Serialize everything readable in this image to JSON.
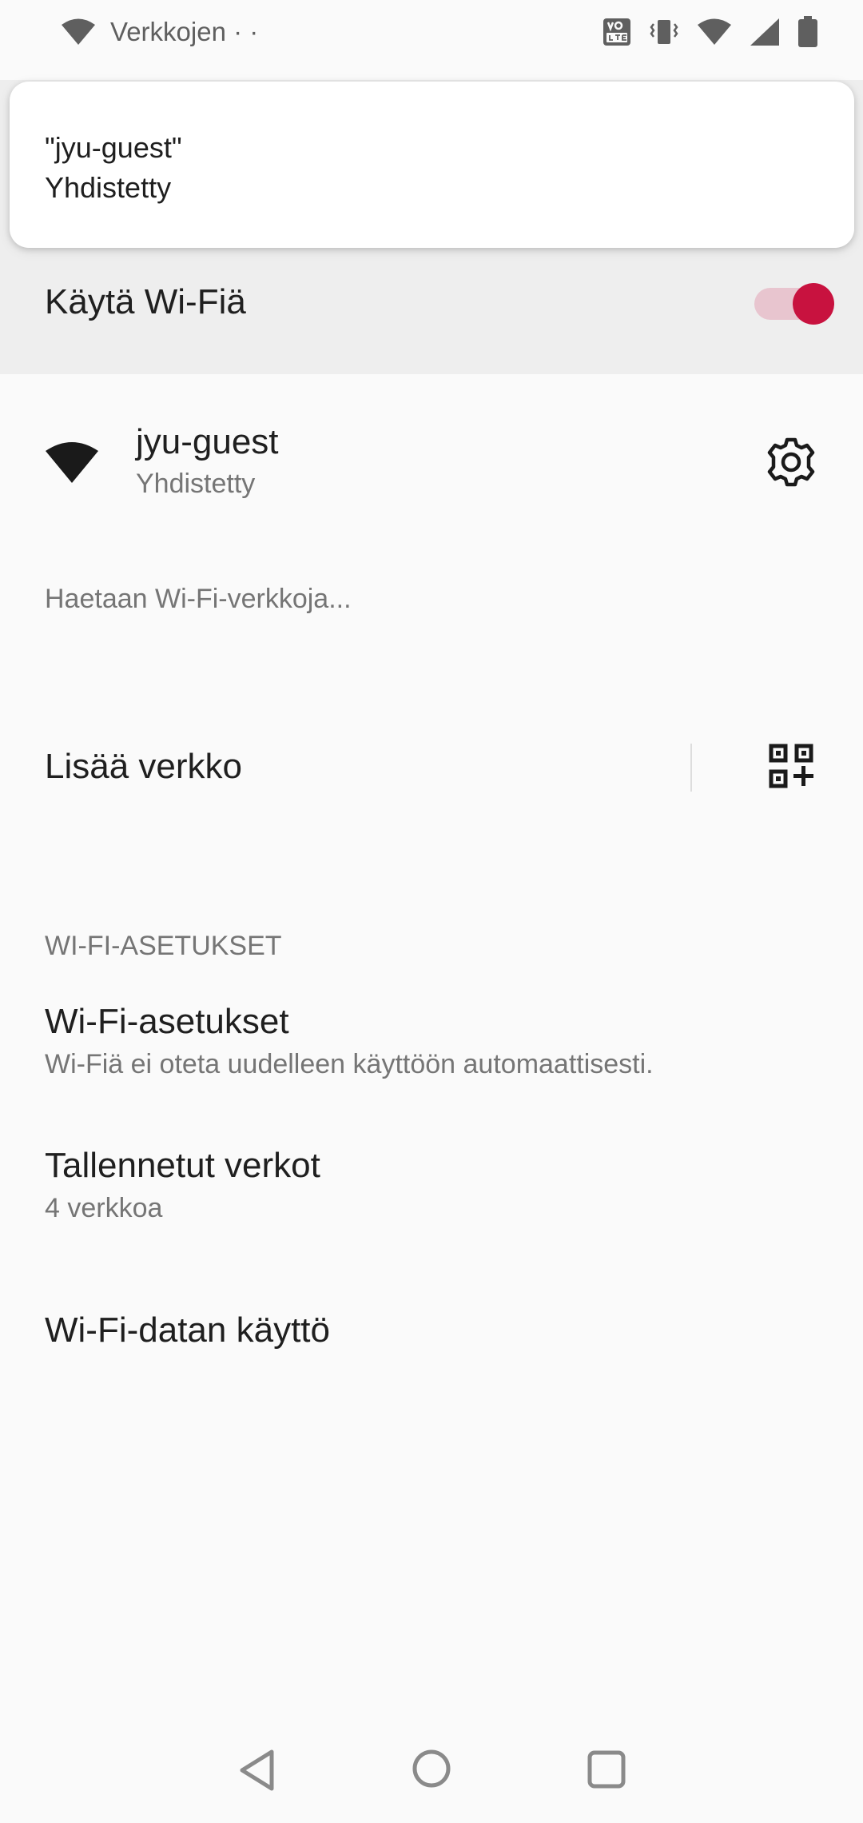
{
  "status_bar": {
    "carrier_text": "Verkkojen · ·",
    "icons": [
      "wifi-icon",
      "volte-icon",
      "vibrate-icon",
      "wifi-icon",
      "signal-icon",
      "battery-icon"
    ]
  },
  "toast": {
    "line1": "\"jyu-guest\"",
    "line2": "Yhdistetty"
  },
  "wifi_toggle": {
    "label": "Käytä Wi-Fiä",
    "enabled": true,
    "accent_color": "#c8123f"
  },
  "connected_network": {
    "ssid": "jyu-guest",
    "status": "Yhdistetty",
    "icon": "wifi-full-icon",
    "settings_icon": "gear-icon"
  },
  "scanning_text": "Haetaan Wi-Fi-verkkoja...",
  "add_network": {
    "label": "Lisää verkko",
    "icon": "qr-add-icon"
  },
  "section_header": "WI-FI-ASETUKSET",
  "preferences": [
    {
      "title": "Wi-Fi-asetukset",
      "summary": "Wi-Fiä ei oteta uudelleen käyttöön automaattisesti."
    },
    {
      "title": "Tallennetut verkot",
      "summary": "4 verkkoa"
    },
    {
      "title": "Wi-Fi-datan käyttö"
    }
  ],
  "nav_bar": {
    "buttons": [
      "back-icon",
      "home-icon",
      "recents-icon"
    ]
  }
}
